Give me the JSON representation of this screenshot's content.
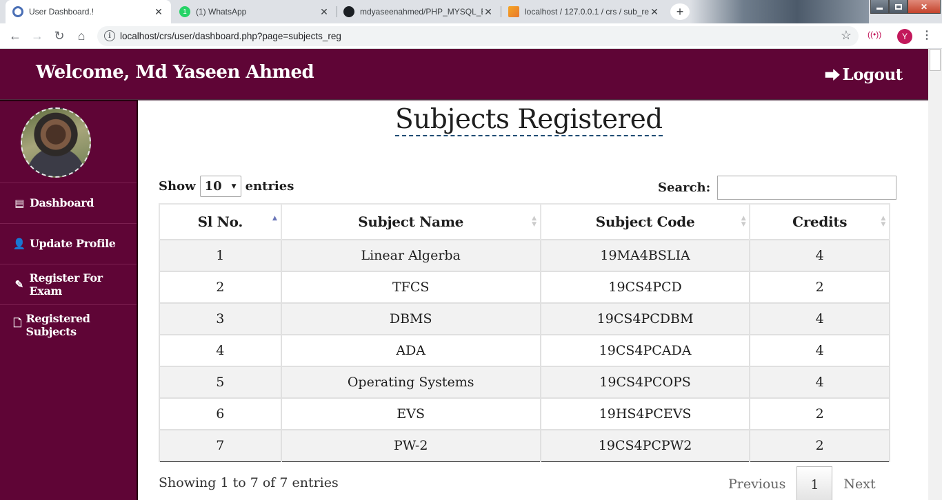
{
  "browser": {
    "tabs": [
      {
        "title": "User Dashboard.!",
        "favicon": "chrome-page-icon",
        "active": true
      },
      {
        "title": "(1) WhatsApp",
        "favicon": "whatsapp-icon",
        "badge": "1"
      },
      {
        "title": "mdyaseenahmed/PHP_MYSQL_E",
        "favicon": "github-icon"
      },
      {
        "title": "localhost / 127.0.0.1 / crs / sub_re",
        "favicon": "phpmyadmin-icon"
      }
    ],
    "close_glyph": "✕",
    "new_tab_glyph": "+",
    "url": "localhost/crs/user/dashboard.php?page=subjects_reg",
    "profile_initial": "Y"
  },
  "header": {
    "welcome": "Welcome, Md Yaseen Ahmed",
    "logout": "Logout",
    "bg_color": "#5f0536"
  },
  "sidebar": {
    "items": [
      {
        "label": "Dashboard",
        "icon": "files-icon"
      },
      {
        "label": "Update Profile",
        "icon": "user-edit-icon"
      },
      {
        "label": "Register For Exam",
        "icon": "pencil-icon"
      },
      {
        "label": "Registered Subjects",
        "icon": "document-icon"
      }
    ]
  },
  "main": {
    "title": "Subjects Registered",
    "show_label": "Show",
    "entries_label": "entries",
    "page_length": "10",
    "search_label": "Search:",
    "search_value": "",
    "columns": [
      "Sl No.",
      "Subject Name",
      "Subject Code",
      "Credits"
    ],
    "rows": [
      [
        "1",
        "Linear Algerba",
        "19MA4BSLIA",
        "4"
      ],
      [
        "2",
        "TFCS",
        "19CS4PCD",
        "2"
      ],
      [
        "3",
        "DBMS",
        "19CS4PCDBM",
        "4"
      ],
      [
        "4",
        "ADA",
        "19CS4PCADA",
        "4"
      ],
      [
        "5",
        "Operating Systems",
        "19CS4PCOPS",
        "4"
      ],
      [
        "6",
        "EVS",
        "19HS4PCEVS",
        "2"
      ],
      [
        "7",
        "PW-2",
        "19CS4PCPW2",
        "2"
      ]
    ],
    "info": "Showing 1 to 7 of 7 entries",
    "pagination": {
      "previous": "Previous",
      "current": "1",
      "next": "Next"
    }
  }
}
